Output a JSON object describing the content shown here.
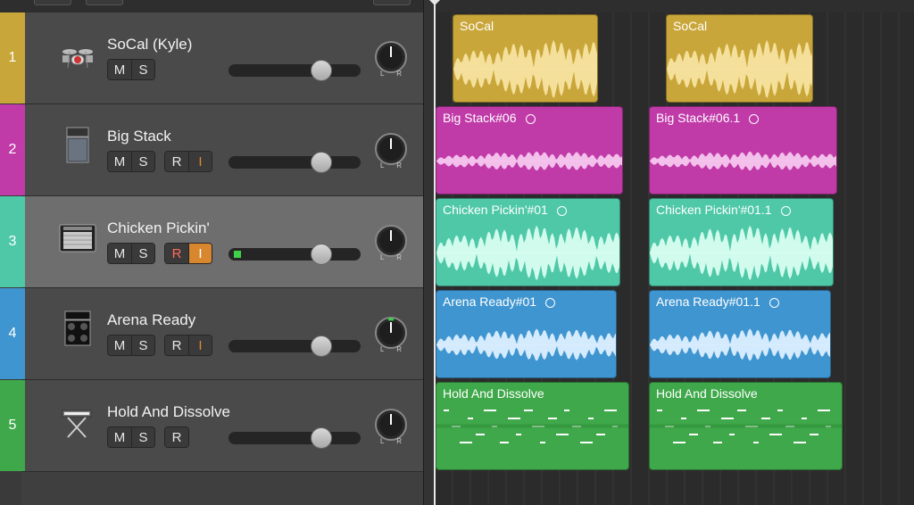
{
  "tracks": [
    {
      "number": "1",
      "name": "SoCal (Kyle)",
      "color": "#c9a63a",
      "icon": "drum-kit-icon",
      "buttons": [
        "M",
        "S"
      ],
      "rec": null,
      "input": null,
      "volume": 0.7,
      "pan_indicator": "none",
      "selected": false
    },
    {
      "number": "2",
      "name": "Big Stack",
      "color": "#c03aa8",
      "icon": "amp-stack-icon",
      "buttons": [
        "M",
        "S"
      ],
      "rec": "R",
      "input": "I",
      "volume": 0.7,
      "pan_indicator": "none",
      "selected": false
    },
    {
      "number": "3",
      "name": "Chicken Pickin'",
      "color": "#4fc8a8",
      "icon": "combo-amp-icon",
      "buttons": [
        "M",
        "S"
      ],
      "rec": "R",
      "input": "I",
      "volume": 0.7,
      "pan_indicator": "none",
      "selected": true
    },
    {
      "number": "4",
      "name": "Arena Ready",
      "color": "#3f95cf",
      "icon": "amp-head-cab-icon",
      "buttons": [
        "M",
        "S"
      ],
      "rec": "R",
      "input": "I",
      "volume": 0.7,
      "pan_indicator": "green",
      "selected": false
    },
    {
      "number": "5",
      "name": "Hold And Dissolve",
      "color": "#3fa84a",
      "icon": "keyboard-stand-icon",
      "buttons": [
        "M",
        "S"
      ],
      "rec": "R",
      "input": null,
      "volume": 0.7,
      "pan_indicator": "none",
      "selected": false
    }
  ],
  "regions": [
    {
      "track": 0,
      "label": "SoCal",
      "loop": false,
      "style": "drums"
    },
    {
      "track": 0,
      "label": "SoCal",
      "loop": false,
      "style": "drums"
    },
    {
      "track": 1,
      "label": "Big Stack#06",
      "loop": true,
      "style": "audio-thin"
    },
    {
      "track": 1,
      "label": "Big Stack#06.1",
      "loop": true,
      "style": "audio-thin"
    },
    {
      "track": 2,
      "label": "Chicken Pickin'#01",
      "loop": true,
      "style": "audio-big"
    },
    {
      "track": 2,
      "label": "Chicken Pickin'#01.1",
      "loop": true,
      "style": "audio-big"
    },
    {
      "track": 3,
      "label": "Arena Ready#01",
      "loop": true,
      "style": "audio-mid"
    },
    {
      "track": 3,
      "label": "Arena Ready#01.1",
      "loop": true,
      "style": "audio-mid"
    },
    {
      "track": 4,
      "label": "Hold And Dissolve",
      "loop": false,
      "style": "midi"
    },
    {
      "track": 4,
      "label": "Hold And Dissolve",
      "loop": false,
      "style": "midi"
    }
  ],
  "colors": {
    "drums": "#c9a63a",
    "bigstack": "#c03aa8",
    "chicken": "#4fc8a8",
    "arena": "#3f95cf",
    "hold": "#3fa84a",
    "mute_button": "#3a3a3a",
    "input_on": "#d8872e"
  }
}
